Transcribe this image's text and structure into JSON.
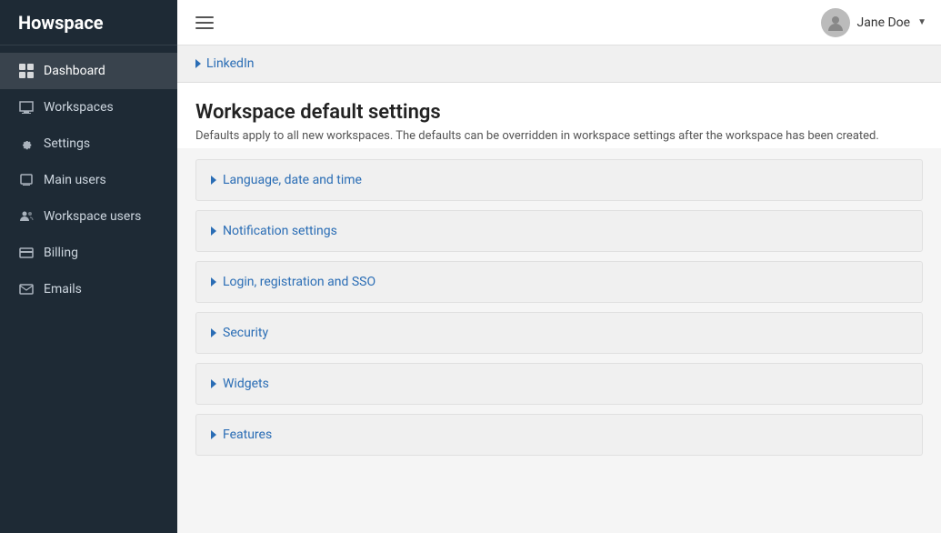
{
  "app": {
    "logo": "Howspace"
  },
  "topbar": {
    "user_name": "Jane Doe",
    "dropdown_arrow": "▼"
  },
  "sidebar": {
    "items": [
      {
        "id": "dashboard",
        "label": "Dashboard",
        "active": true
      },
      {
        "id": "workspaces",
        "label": "Workspaces",
        "active": false
      },
      {
        "id": "settings",
        "label": "Settings",
        "active": false
      },
      {
        "id": "main-users",
        "label": "Main users",
        "active": false
      },
      {
        "id": "workspace-users",
        "label": "Workspace users",
        "active": false
      },
      {
        "id": "billing",
        "label": "Billing",
        "active": false
      },
      {
        "id": "emails",
        "label": "Emails",
        "active": false
      }
    ]
  },
  "content": {
    "linkedin_label": "LinkedIn",
    "section_title": "Workspace default settings",
    "section_subtitle": "Defaults apply to all new workspaces. The defaults can be overridden in workspace settings after the workspace has been created.",
    "accordion_items": [
      {
        "id": "language",
        "label": "Language, date and time"
      },
      {
        "id": "notification",
        "label": "Notification settings"
      },
      {
        "id": "login",
        "label": "Login, registration and SSO"
      },
      {
        "id": "security",
        "label": "Security"
      },
      {
        "id": "widgets",
        "label": "Widgets"
      },
      {
        "id": "features",
        "label": "Features"
      }
    ]
  }
}
